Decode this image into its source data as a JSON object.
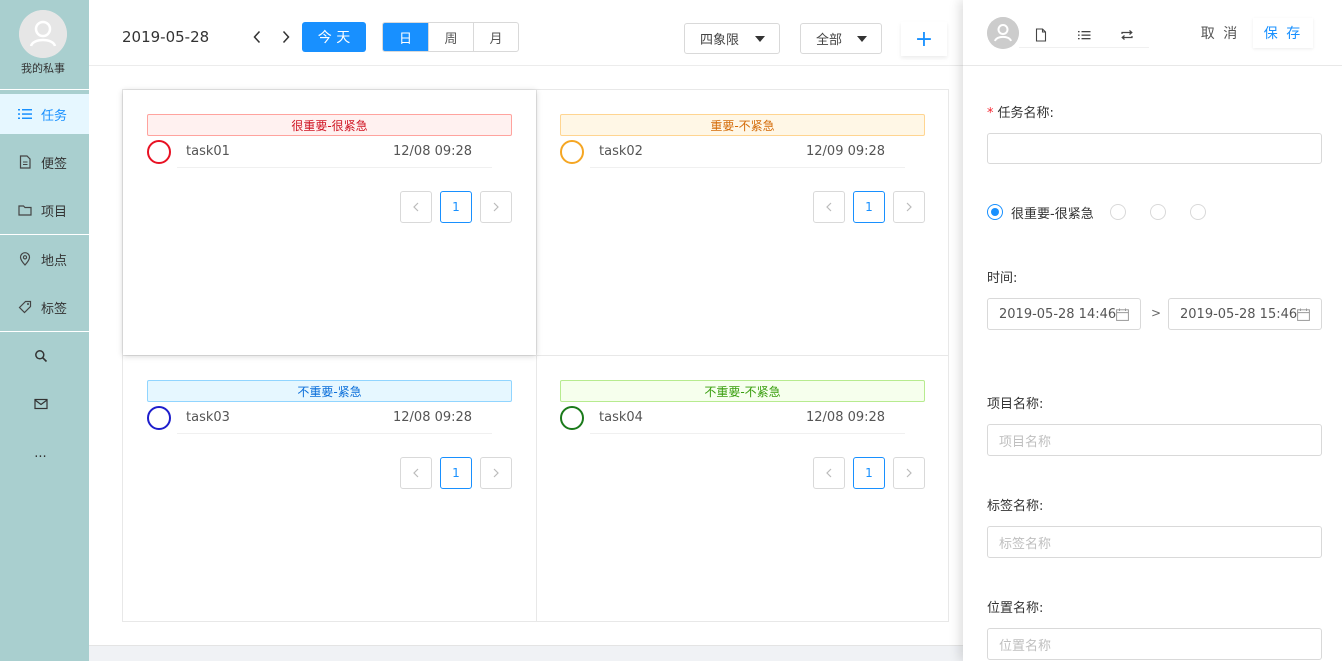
{
  "sidebar": {
    "username": "我的私事",
    "items": [
      {
        "label": "任务",
        "icon": "list-icon"
      },
      {
        "label": "便签",
        "icon": "note-icon"
      },
      {
        "label": "项目",
        "icon": "folder-icon"
      },
      {
        "label": "地点",
        "icon": "location-icon"
      },
      {
        "label": "标签",
        "icon": "tag-icon"
      }
    ],
    "more_label": "..."
  },
  "toolbar": {
    "date": "2019-05-28",
    "today_label": "今 天",
    "views": [
      "日",
      "周",
      "月"
    ],
    "active_view": "日",
    "quadrant_dropdown": "四象限",
    "filter_dropdown": "全部",
    "add_label": "+"
  },
  "quadrants": [
    {
      "title": "很重要-很紧急",
      "color": "#f5222d",
      "bg": "#fff1f0",
      "border": "#ffa39e",
      "text": "#cf1322",
      "ring": "#e81123",
      "task": {
        "name": "task01",
        "time": "12/08 09:28"
      },
      "page": "1"
    },
    {
      "title": "重要-不紧急",
      "color": "#fa8c16",
      "bg": "#fff7e6",
      "border": "#ffd591",
      "text": "#d46b08",
      "ring": "#f5a623",
      "task": {
        "name": "task02",
        "time": "12/09 09:28"
      },
      "page": "1"
    },
    {
      "title": "不重要-紧急",
      "color": "#1890ff",
      "bg": "#e6f7ff",
      "border": "#91d5ff",
      "text": "#096dd9",
      "ring": "#1d1dcc",
      "task": {
        "name": "task03",
        "time": "12/08 09:28"
      },
      "page": "1"
    },
    {
      "title": "不重要-不紧急",
      "color": "#52c41a",
      "bg": "#f6ffed",
      "border": "#b7eb8f",
      "text": "#389e0d",
      "ring": "#1a7a1a",
      "task": {
        "name": "task04",
        "time": "12/08 09:28"
      },
      "page": "1"
    }
  ],
  "drawer": {
    "cancel_label": "取 消",
    "save_label": "保 存",
    "task_name_label": "任务名称:",
    "task_name_value": "",
    "priority_selected_label": "很重要-很紧急",
    "time_label": "时间:",
    "start_time": "2019-05-28 14:46",
    "end_time": "2019-05-28 15:46",
    "time_separator": ">",
    "project_label": "项目名称:",
    "project_placeholder": "项目名称",
    "tag_label": "标签名称:",
    "tag_placeholder": "标签名称",
    "location_label": "位置名称:",
    "location_placeholder": "位置名称"
  }
}
